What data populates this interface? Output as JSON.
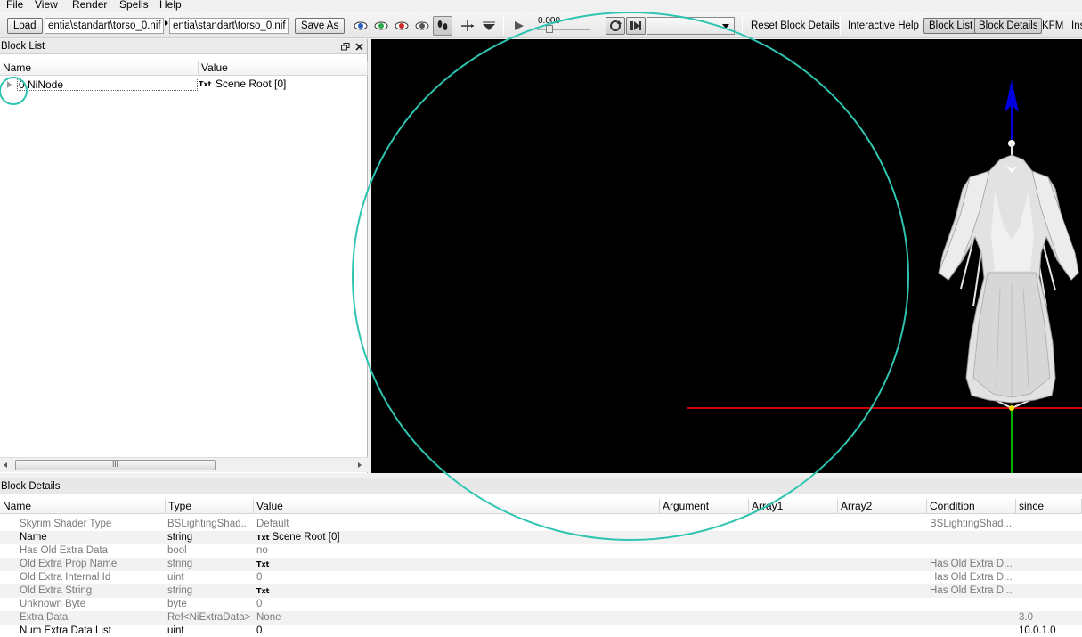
{
  "menu": [
    "File",
    "View",
    "Render",
    "Spells",
    "Help"
  ],
  "toolbar": {
    "load_label": "Load",
    "load_path": "entia\\standart\\torso_0.nif",
    "save_path": "entia\\standart\\torso_0.nif",
    "save_as_label": "Save As",
    "time_value": "0.000",
    "reset_block_details": "Reset Block Details",
    "interactive_help": "Interactive Help",
    "block_list": "Block List",
    "block_details": "Block Details",
    "kfm": "KFM",
    "ins": "Ins"
  },
  "block_list": {
    "title": "Block List",
    "headers": [
      "Name",
      "Value"
    ],
    "rows": [
      {
        "name": "0 NiNode",
        "value": "Scene Root [0]",
        "value_tag": "Txt"
      }
    ],
    "scrollbar_grip": "III"
  },
  "block_details": {
    "title": "Block Details",
    "headers": [
      "Name",
      "Type",
      "Value",
      "Argument",
      "Array1",
      "Array2",
      "Condition",
      "since"
    ],
    "rows": [
      {
        "name": "Skyrim Shader Type",
        "type": "BSLightingShad...",
        "value": "Default",
        "tag": "",
        "condition": "BSLightingShad...",
        "since": "",
        "dim": true
      },
      {
        "name": "Name",
        "type": "string",
        "value": "Scene Root [0]",
        "tag": "Txt",
        "condition": "",
        "since": "",
        "dim": false
      },
      {
        "name": "Has Old Extra Data",
        "type": "bool",
        "value": "no",
        "tag": "",
        "condition": "",
        "since": "",
        "dim": true
      },
      {
        "name": "Old Extra Prop Name",
        "type": "string",
        "value": "",
        "tag": "Txt",
        "condition": "Has Old Extra D...",
        "since": "",
        "dim": true
      },
      {
        "name": "Old Extra Internal Id",
        "type": "uint",
        "value": "0",
        "tag": "",
        "condition": "Has Old Extra D...",
        "since": "",
        "dim": true
      },
      {
        "name": "Old Extra String",
        "type": "string",
        "value": "",
        "tag": "Txt",
        "condition": "Has Old Extra D...",
        "since": "",
        "dim": true
      },
      {
        "name": "Unknown Byte",
        "type": "byte",
        "value": "0",
        "tag": "",
        "condition": "",
        "since": "",
        "dim": true
      },
      {
        "name": "Extra Data",
        "type": "Ref<NiExtraData>",
        "value": "None",
        "tag": "",
        "condition": "",
        "since": "3.0",
        "dim": true
      },
      {
        "name": "Num Extra Data List",
        "type": "uint",
        "value": "0",
        "tag": "",
        "condition": "",
        "since": "10.0.1.0",
        "dim": false
      }
    ]
  },
  "colors": {
    "annotation": "#2ec4b0",
    "axis_x": "#d00000",
    "axis_y": "#00b000",
    "axis_z": "#0000e0"
  }
}
